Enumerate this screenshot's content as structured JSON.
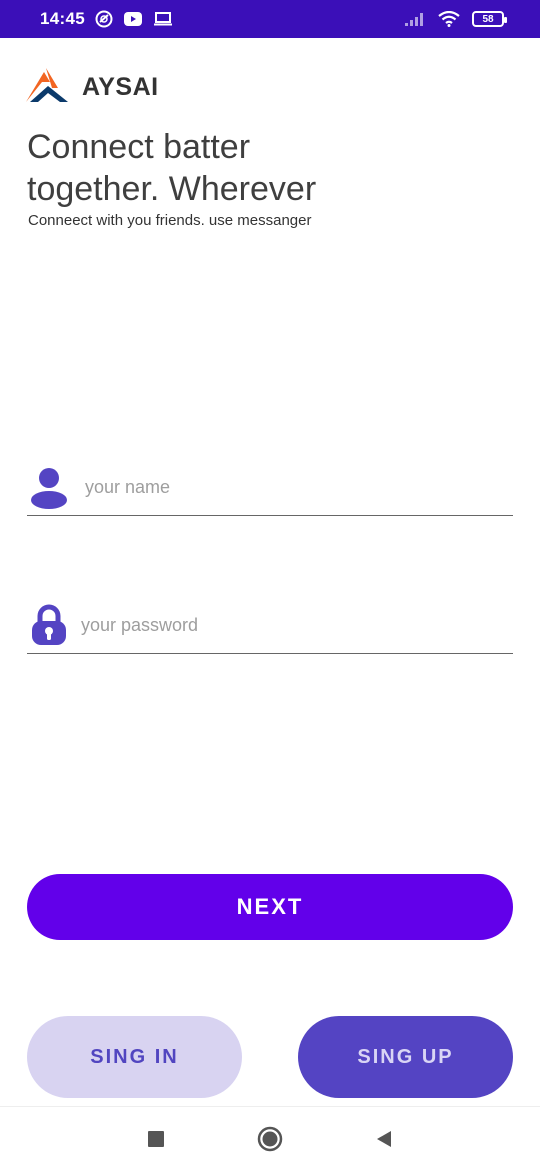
{
  "status_bar": {
    "time": "14:45",
    "battery": "58",
    "icons": [
      "location-icon",
      "youtube-icon",
      "laptop-icon",
      "signal-icon",
      "wifi-icon",
      "battery-icon"
    ]
  },
  "brand": {
    "name": "AYSAI",
    "logo_colors": {
      "orange": "#f26522",
      "navy": "#0b3a6b"
    }
  },
  "headline": {
    "line1": "Connect batter",
    "line2": "together. Wherever",
    "subtitle": "Conneect with you friends. use messanger"
  },
  "form": {
    "name_placeholder": "your name",
    "name_value": "",
    "password_placeholder": "your password",
    "password_value": "",
    "icon_color": "#5444c3"
  },
  "buttons": {
    "next": "NEXT",
    "sign_in": "SING IN",
    "sign_up": "SING UP"
  },
  "colors": {
    "status_bar": "#3b0fb8",
    "primary": "#6200ea",
    "secondary": "#5444c3",
    "secondary_light": "#d8d3f1"
  },
  "nav_bar": {
    "icons": [
      "recents-square-icon",
      "home-circle-icon",
      "back-triangle-icon"
    ]
  }
}
